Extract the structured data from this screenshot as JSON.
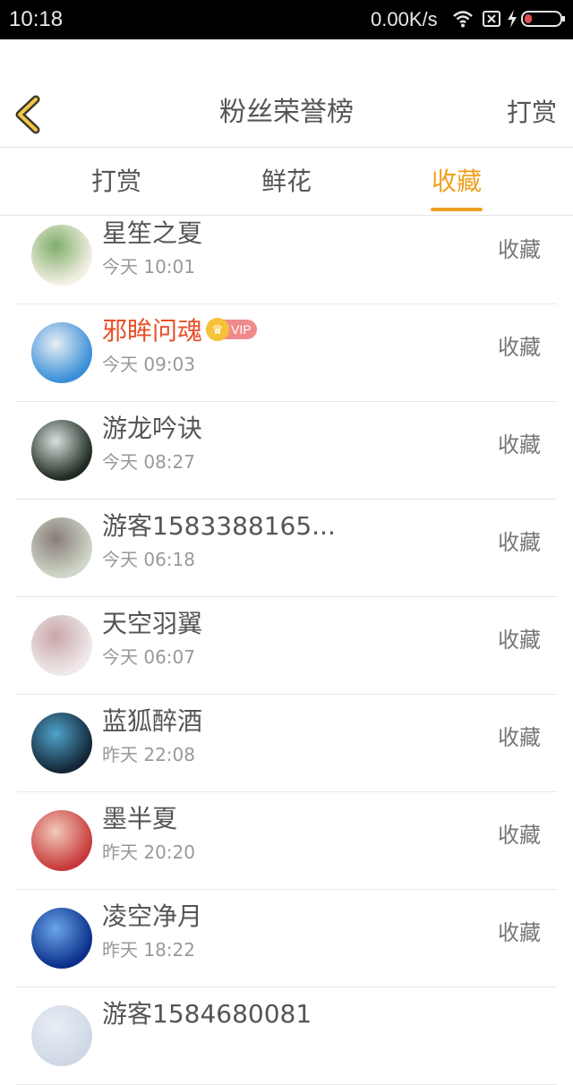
{
  "status_bar": {
    "time": "10:18",
    "net_speed": "0.00K/s"
  },
  "header": {
    "title": "粉丝荣誉榜",
    "action_label": "打赏",
    "back_icon": "chevron-left-icon"
  },
  "tabs": [
    {
      "label": "打赏",
      "active": false
    },
    {
      "label": "鲜花",
      "active": false
    },
    {
      "label": "收藏",
      "active": true
    }
  ],
  "accent_color": "#f0a020",
  "rows": [
    {
      "name": "星笙之夏",
      "time": "今天 10:01",
      "action": "收藏",
      "vip": false,
      "avatar_colors": [
        "#f3efe3",
        "#7fae6a"
      ]
    },
    {
      "name": "邪眸问魂",
      "time": "今天 09:03",
      "action": "收藏",
      "vip": true,
      "vip_label": "VIP",
      "avatar_colors": [
        "#3a8fd8",
        "#e8eef5"
      ]
    },
    {
      "name": "游龙吟诀",
      "time": "今天 08:27",
      "action": "收藏",
      "vip": false,
      "avatar_colors": [
        "#1e2a22",
        "#d9e0dc"
      ]
    },
    {
      "name": "游客1583388165...",
      "time": "今天 06:18",
      "action": "收藏",
      "vip": false,
      "avatar_colors": [
        "#cfd7c8",
        "#8a7d78"
      ]
    },
    {
      "name": "天空羽翼",
      "time": "今天 06:07",
      "action": "收藏",
      "vip": false,
      "avatar_colors": [
        "#efe9ea",
        "#c9a7a8"
      ]
    },
    {
      "name": "蓝狐醉酒",
      "time": "昨天 22:08",
      "action": "收藏",
      "vip": false,
      "avatar_colors": [
        "#142638",
        "#4fa3c9"
      ]
    },
    {
      "name": "墨半夏",
      "time": "昨天 20:20",
      "action": "收藏",
      "vip": false,
      "avatar_colors": [
        "#c83a3a",
        "#f2c9b9"
      ]
    },
    {
      "name": "凌空净月",
      "time": "昨天 18:22",
      "action": "收藏",
      "vip": false,
      "avatar_colors": [
        "#0b2f8a",
        "#6aa6ea"
      ]
    },
    {
      "name": "游客1584680081",
      "time": "",
      "action": "",
      "vip": false,
      "avatar_colors": [
        "#cfd8e6",
        "#e9eef5"
      ]
    }
  ]
}
